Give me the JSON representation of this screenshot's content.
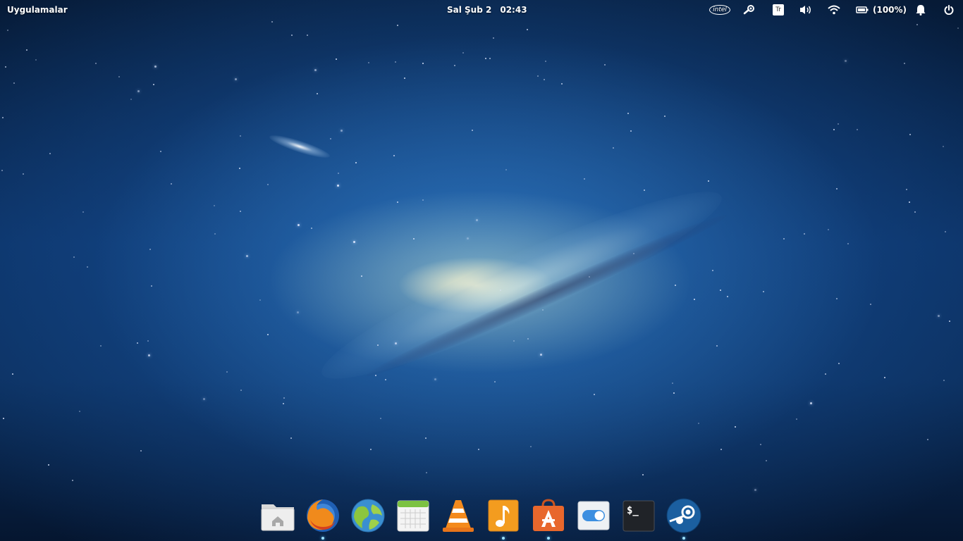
{
  "top_panel": {
    "apps_menu_label": "Uygulamalar",
    "clock": {
      "date": "Sal Şub  2",
      "time": "02:43"
    },
    "indicators": {
      "intel_label": "intel",
      "keyboard_layout": "Tr",
      "battery_percent": "(100%)"
    }
  },
  "dock": {
    "items": [
      {
        "name": "Files",
        "icon": "home-folder-icon",
        "running": false
      },
      {
        "name": "Firefox",
        "icon": "firefox-icon",
        "running": true
      },
      {
        "name": "Web Browser",
        "icon": "globe-icon",
        "running": false
      },
      {
        "name": "Calendar",
        "icon": "calendar-icon",
        "running": false
      },
      {
        "name": "VLC",
        "icon": "vlc-cone-icon",
        "running": false
      },
      {
        "name": "Music",
        "icon": "music-note-icon",
        "running": true
      },
      {
        "name": "AppCenter",
        "icon": "app-store-bag-icon",
        "running": true
      },
      {
        "name": "System Settings",
        "icon": "toggle-switch-icon",
        "running": false
      },
      {
        "name": "Terminal",
        "icon": "terminal-icon",
        "running": false
      },
      {
        "name": "Steam",
        "icon": "steam-icon",
        "running": true
      }
    ],
    "terminal_glyph": "$_"
  },
  "colors": {
    "panel_text": "#ffffff",
    "wallpaper_base": "#0b3062",
    "music_orange": "#f39c1f",
    "appcenter_orange": "#e8672c",
    "calendar_green": "#7cc242",
    "steam_blue": "#1b5fa0"
  }
}
